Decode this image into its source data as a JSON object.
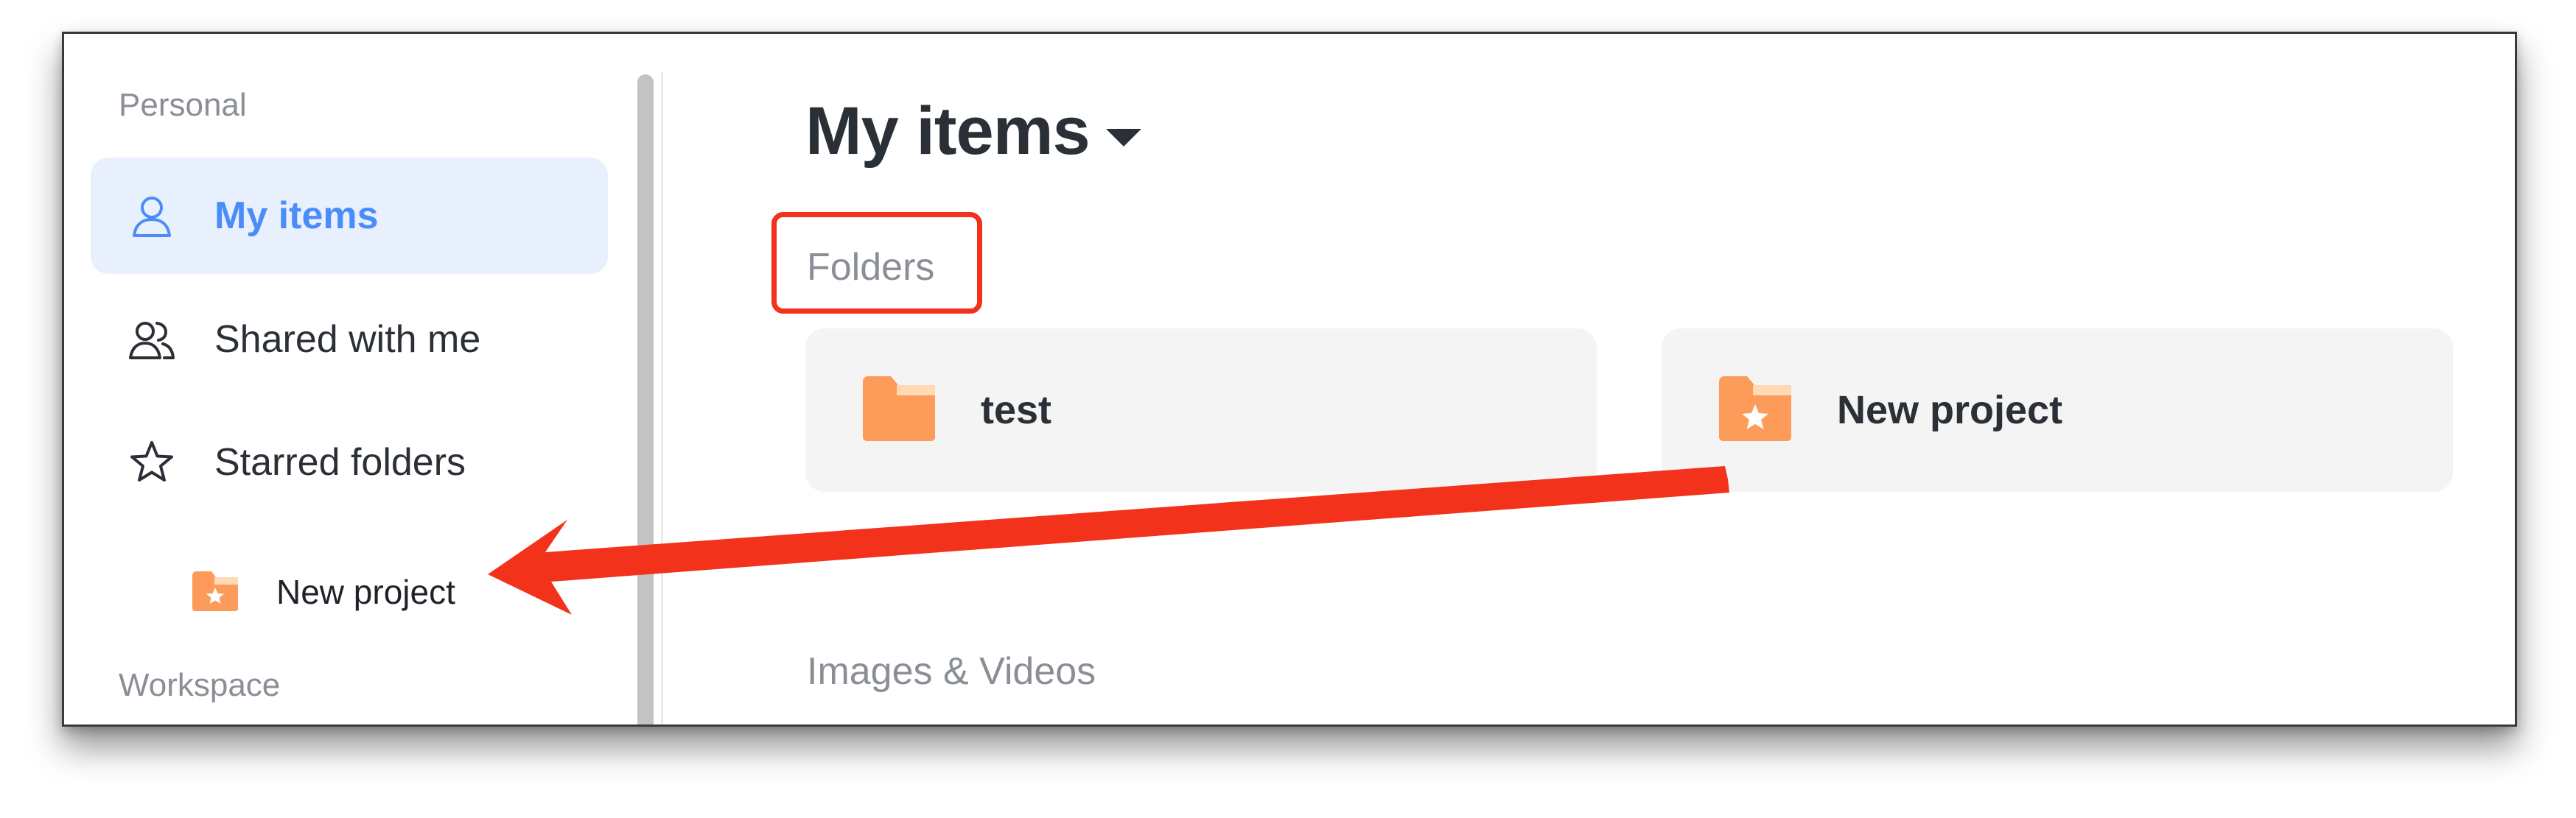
{
  "sidebar": {
    "personal_label": "Personal",
    "workspace_label": "Workspace",
    "items": [
      {
        "label": "My items",
        "icon": "user-icon",
        "active": true
      },
      {
        "label": "Shared with me",
        "icon": "users-icon",
        "active": false
      },
      {
        "label": "Starred folders",
        "icon": "star-icon",
        "active": false
      }
    ],
    "starred": [
      {
        "label": "New project",
        "icon": "starred-folder-icon"
      }
    ]
  },
  "main": {
    "title": "My items",
    "folders_label": "Folders",
    "folders": [
      {
        "label": "test",
        "icon": "folder-icon"
      },
      {
        "label": "New project",
        "icon": "starred-folder-icon"
      }
    ],
    "media_label": "Images & Videos"
  },
  "colors": {
    "accent": "#4b8df8",
    "active_bg": "#e8f0fd",
    "folder_orange": "#fd9b5a",
    "annotation_red": "#f2321a"
  }
}
